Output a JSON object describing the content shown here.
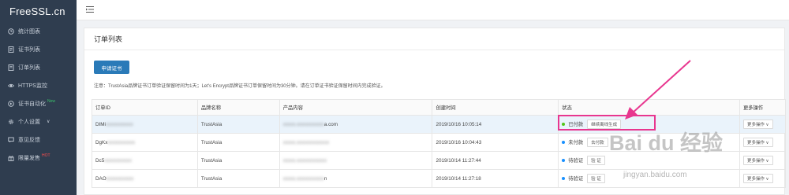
{
  "brand": "FreeSSL.cn",
  "sidebar": {
    "items": [
      {
        "label": "统计图表",
        "icon": "clock-icon"
      },
      {
        "label": "证书列表",
        "icon": "certificate-icon"
      },
      {
        "label": "订单列表",
        "icon": "order-icon"
      },
      {
        "label": "HTTPS监控",
        "icon": "monitor-icon"
      },
      {
        "label": "证书自动化",
        "icon": "automation-icon",
        "badge": "New"
      },
      {
        "label": "个人设置",
        "icon": "gear-icon",
        "caret": "∨"
      },
      {
        "label": "意见反馈",
        "icon": "feedback-icon"
      },
      {
        "label": "限量发售",
        "icon": "gift-icon",
        "badge": "HOT"
      }
    ]
  },
  "panel": {
    "title": "订单列表",
    "apply_button": "申请证书",
    "notice": "注意：TrustAsia品牌证书订单验证保留时间为1天；Let's Encrypt品牌证书订单保留时间为30分钟。请在订单证书验证保留时间内完成验证。"
  },
  "table": {
    "headers": [
      "订单ID",
      "品牌名称",
      "产品内容",
      "创建时间",
      "状态",
      "更多操作"
    ],
    "rows": [
      {
        "id_prefix": "DIMi",
        "id_blur": "xxxxxxxxxxx",
        "brand": "TrustAsia",
        "product_blur": "xxxxx.xxxxxxxxxxx",
        "product_suffix": "a.com",
        "created": "2019/10/16 10:05:14",
        "status": "已付款",
        "status_color": "#52c41a",
        "action": "继续离线生成",
        "more": "更多操作 ∨"
      },
      {
        "id_prefix": "DgKx",
        "id_blur": "xxxxxxxxxxx",
        "brand": "TrustAsia",
        "product_blur": "xxxxx.xxxxxxxxxxxxx",
        "product_suffix": "",
        "created": "2019/10/16 10:04:43",
        "status": "未付款",
        "status_color": "#1890ff",
        "action": "去付款",
        "more": "更多操作 ∨"
      },
      {
        "id_prefix": "Dc5",
        "id_blur": "xxxxxxxxxxx",
        "brand": "TrustAsia",
        "product_blur": "xxxxx.xxxxxxxxxxxx",
        "product_suffix": "",
        "created": "2019/10/14 11:27:44",
        "status": "待验证",
        "status_color": "#1890ff",
        "action": "验 证",
        "more": "更多操作 ∨"
      },
      {
        "id_prefix": "DAO",
        "id_blur": "xxxxxxxxxxx",
        "brand": "TrustAsia",
        "product_blur": "xxxxx.xxxxxxxxxxx",
        "product_suffix": "n",
        "created": "2019/10/14 11:27:18",
        "status": "待验证",
        "status_color": "#1890ff",
        "action": "验 证",
        "more": "更多操作 ∨"
      }
    ]
  },
  "watermark": {
    "main": "Bai du 经验",
    "sub": "jingyan.baidu.com"
  },
  "colors": {
    "sidebar_bg": "#2f3d4f",
    "primary": "#2a7ab8",
    "highlight": "#e8368f"
  }
}
